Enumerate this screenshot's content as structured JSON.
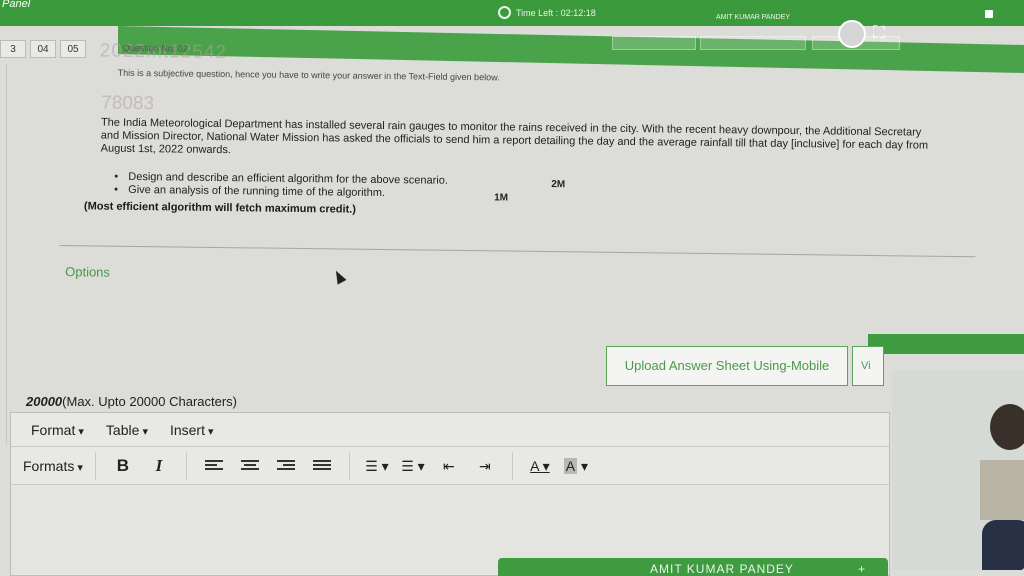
{
  "header": {
    "brand": "Panel",
    "timer_label": "Time Left : 02:12:18",
    "user_name": "AMIT KUMAR PANDEY"
  },
  "question_nav": [
    "3",
    "04",
    "05"
  ],
  "question": {
    "number_label": "Question No: 02",
    "watermark_1": "2022mt12542",
    "watermark_2": "78083",
    "subjective_note": "This is a subjective question, hence you have to write your answer in the Text-Field given below.",
    "body": "The India Meteorological Department has installed several rain gauges to monitor the rains received in the city. With the recent heavy downpour, the Additional Secretary and Mission Director, National Water Mission has asked the officials to send him a report detailing the day and the average rainfall till that day [inclusive] for each day from August 1st, 2022 onwards.",
    "bullets": [
      "Design and describe an efficient algorithm for the above scenario.",
      "Give an analysis of the running time of the algorithm."
    ],
    "marks": [
      "2M",
      "1M"
    ],
    "note": "(Most efficient algorithm will fetch maximum credit.)"
  },
  "options_label": "Options",
  "upload": {
    "button_label": "Upload Answer Sheet Using-Mobile",
    "side_button_label": "Vi"
  },
  "editor": {
    "char_limit_value": "20000",
    "char_limit_text": "(Max. Upto 20000 Characters)",
    "menus": [
      "Format",
      "Table",
      "Insert"
    ],
    "formats_label": "Formats",
    "bold": "B",
    "italic": "I",
    "text_color": "A",
    "bg_color": "A"
  },
  "footer_bar": {
    "user_name": "AMIT KUMAR PANDEY",
    "plus": "+"
  },
  "colors": {
    "accent_green": "#3f9b3f",
    "options_text": "#4a9a4a"
  }
}
